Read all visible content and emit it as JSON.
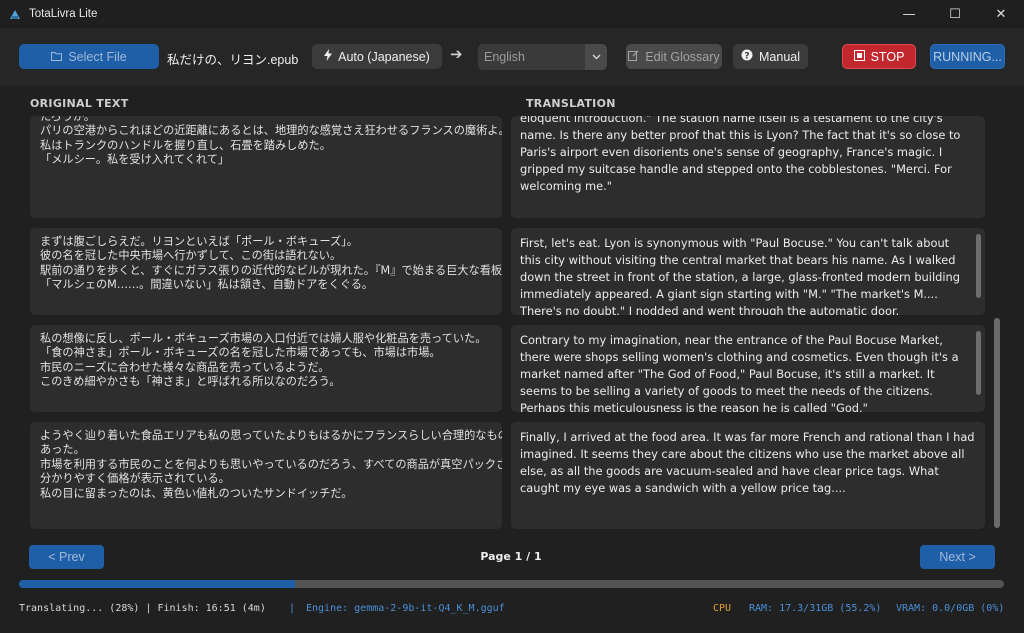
{
  "window": {
    "title": "TotaLivra Lite",
    "controls": [
      "—",
      "☐",
      "✕"
    ]
  },
  "toolbar": {
    "select_file": "Select File",
    "file_name": "私だけの、リヨン.epub",
    "auto_lang": "Auto (Japanese)",
    "arrow": "➔",
    "target_lang": "English",
    "edit_glossary": "Edit Glossary",
    "manual": "Manual",
    "stop": "STOP",
    "running": "RUNNING..."
  },
  "headers": {
    "original": "ORIGINAL TEXT",
    "translation": "TRANSLATION"
  },
  "segments": [
    {
      "original": [
        "たろうか。",
        "パリの空港からこれほどの近距離にあるとは、地理的な感覚さえ狂わせるフランスの魔術よ。",
        "私はトランクのハンドルを握り直し、石畳を踏みしめた。",
        "「メルシー。私を受け入れてくれて」"
      ],
      "translation": "eloquent introduction.\" The station name itself is a testament to the city's name. Is there any better proof that this is Lyon? The fact that it's so close to Paris's airport even disorients one's sense of geography, France's magic. I gripped my suitcase handle and stepped onto the cobblestones. \"Merci. For welcoming me.\""
    },
    {
      "original": [
        "まずは腹ごしらえだ。リヨンといえば「ポール・ボキューズ」。",
        "彼の名を冠した中央市場へ行かずして、この街は語れない。",
        "駅前の通りを歩くと、すぐにガラス張りの近代的なビルが現れた。『M』で始まる巨大な看板。",
        "「マルシェのM……。間違いない」私は頷き、自動ドアをくぐる。"
      ],
      "translation": "First, let's eat. Lyon is synonymous with \"Paul Bocuse.\" You can't talk about this city without visiting the central market that bears his name. As I walked down the street in front of the station, a large, glass-fronted modern building immediately appeared. A giant sign starting with \"M.\" \"The market's M.... There's no doubt.\" I nodded and went through the automatic door."
    },
    {
      "original": [
        "私の想像に反し、ポール・ボキューズ市場の入口付近では婦人服や化粧品を売っていた。",
        "「食の神さま」ポール・ボキューズの名を冠した市場であっても、市場は市場。",
        "市民のニーズに合わせた様々な商品を売っているようだ。",
        "このきめ細やかさも「神さま」と呼ばれる所以なのだろう。"
      ],
      "translation": "Contrary to my imagination, near the entrance of the Paul Bocuse Market, there were shops selling women's clothing and cosmetics. Even though it's a market named after \"The God of Food,\" Paul Bocuse, it's still a market. It seems to be selling a variety of goods to meet the needs of the citizens. Perhaps this meticulousness is the reason he is called \"God.\""
    },
    {
      "original": [
        "ようやく辿り着いた食品エリアも私の思っていたよりもはるかにフランスらしい合理的なもので",
        "あった。",
        "市場を利用する市民のことを何よりも思いやっているのだろう、すべての商品が真空パックされ、",
        "分かりやすく価格が表示されている。",
        "私の目に留まったのは、黄色い値札のついたサンドイッチだ。"
      ],
      "translation": "Finally, I arrived at the food area. It was far more French and rational than I had imagined. It seems they care about the citizens who use the market above all else, as all the goods are vacuum-sealed and have clear price tags. What caught my eye was a sandwich with a yellow price tag...."
    }
  ],
  "pagination": {
    "prev": "< Prev",
    "page": "Page 1 / 1",
    "next": "Next >"
  },
  "progress": {
    "percent": 28
  },
  "status": {
    "left": "Translating... (28%) | Finish: 16:51 (4m)",
    "sep": "|",
    "engine": "Engine: gemma-2-9b-it-Q4_K_M.gguf",
    "cpu": "CPU",
    "ram": "RAM: 17.3/31GB (55.2%)",
    "vram": "VRAM: 0.0/0GB (0%)"
  },
  "colors": {
    "accent_blue": "#1f5fa8",
    "stop_red": "#c1272d",
    "cpu_orange": "#e0a030",
    "status_blue": "#4a8fd8"
  }
}
